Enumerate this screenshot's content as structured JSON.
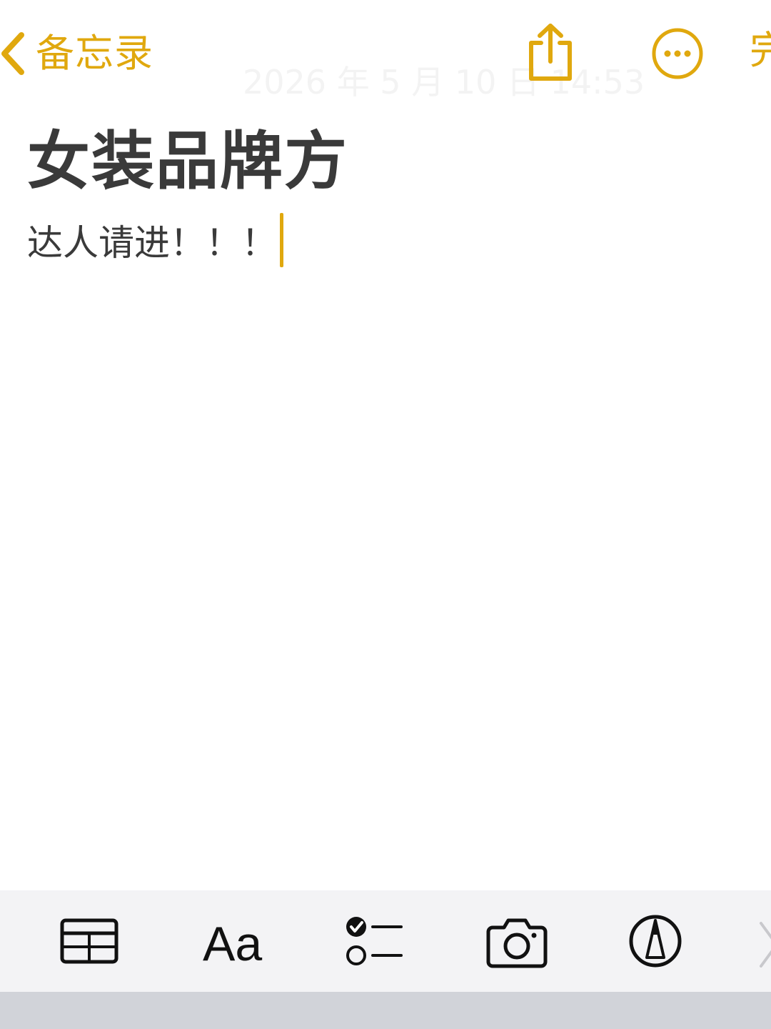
{
  "nav": {
    "back_label": "备忘录",
    "date_text": "2026 年 5 月 10 日 14:53",
    "done_label": "完成"
  },
  "note": {
    "title": "女装品牌方",
    "body": "达人请进！！！"
  },
  "toolbar": {
    "items": [
      "table-icon",
      "format-text-icon",
      "checklist-icon",
      "camera-icon",
      "markup-pen-icon",
      "close-icon"
    ],
    "format_label": "Aa"
  },
  "colors": {
    "accent": "#e0a80e",
    "text": "#3a3a3a",
    "toolbar_bg": "#f3f3f5",
    "keyboard_bg": "#d1d3d9"
  }
}
